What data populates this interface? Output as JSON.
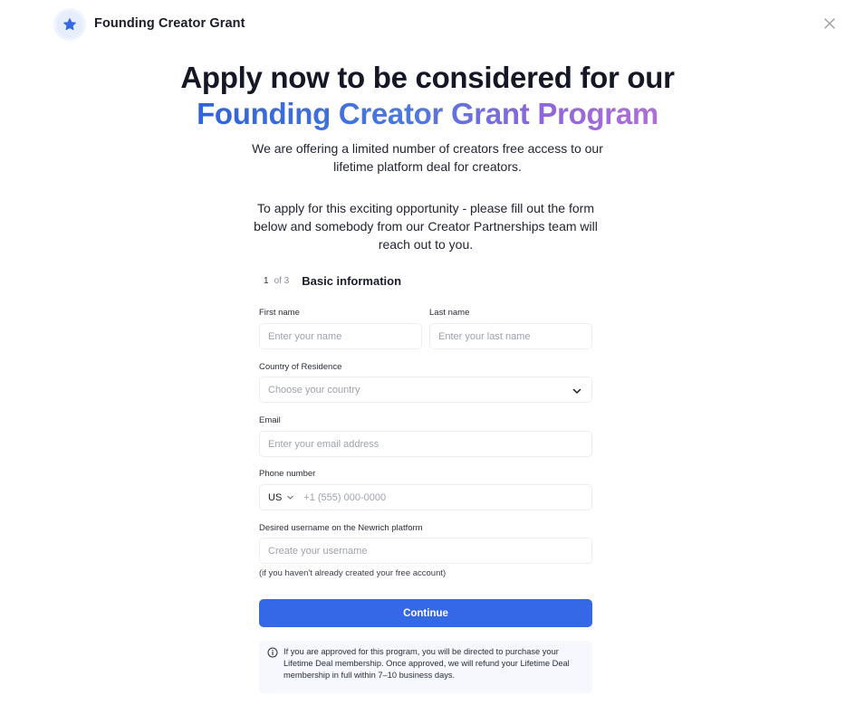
{
  "header": {
    "app_title": "Founding Creator Grant",
    "logo_icon": "star-icon",
    "close_icon": "close-icon"
  },
  "hero": {
    "headline_line1": "Apply now to be considered for our",
    "headline_line2": "Founding Creator Grant Program",
    "subtitle": "We are offering a limited number of creators free access to our lifetime platform deal for creators.",
    "instructions": "To apply for this exciting opportunity - please fill out the form below and somebody from our Creator Partnerships team will reach out to you."
  },
  "step": {
    "current": "1",
    "of": "of 3",
    "title": "Basic information"
  },
  "form": {
    "first_name": {
      "label": "First name",
      "placeholder": "Enter your name",
      "value": ""
    },
    "last_name": {
      "label": "Last name",
      "placeholder": "Enter your last name",
      "value": ""
    },
    "country": {
      "label": "Country of Residence",
      "placeholder": "Choose your country"
    },
    "email": {
      "label": "Email",
      "placeholder": "Enter your email address",
      "value": ""
    },
    "phone": {
      "label": "Phone number",
      "country_code": "US",
      "placeholder": "+1 (555) 000-0000",
      "value": ""
    },
    "username": {
      "label": "Desired username on the Newrich platform",
      "placeholder": "Create your username",
      "value": "",
      "hint": "(if you haven't already created your free account)"
    },
    "continue_label": "Continue"
  },
  "notice": {
    "icon": "info-icon",
    "text": "If you are approved for this program, you will be directed to purchase your Lifetime Deal membership. Once approved, we will refund your Lifetime Deal membership in full within 7–10 business days."
  },
  "colors": {
    "primary": "#3468e6",
    "gradient_start": "#2f63d8",
    "gradient_end": "#b06ed8",
    "notice_bg": "#f6f8fd"
  }
}
